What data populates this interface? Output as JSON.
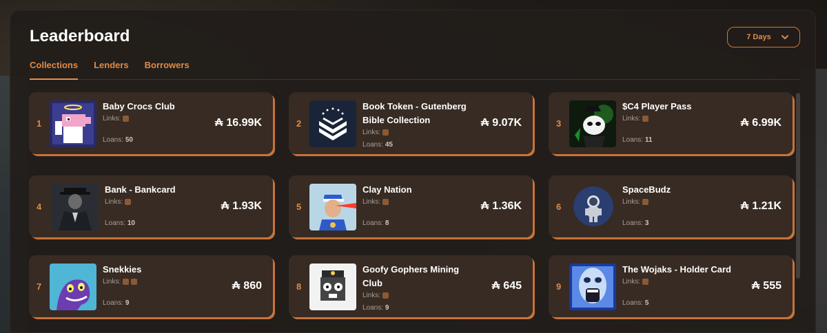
{
  "header": {
    "title": "Leaderboard",
    "period": "7 Days"
  },
  "tabs": [
    {
      "label": "Collections"
    },
    {
      "label": "Lenders"
    },
    {
      "label": "Borrowers"
    }
  ],
  "currency_symbol": "₳",
  "links_label": "Links:",
  "loans_label": "Loans:",
  "collections": [
    {
      "rank": "1",
      "name": "Baby Crocs Club",
      "volume": "16.99K",
      "loans": "50"
    },
    {
      "rank": "2",
      "name": "Book Token - Gutenberg Bible Collection",
      "volume": "9.07K",
      "loans": "45"
    },
    {
      "rank": "3",
      "name": "$C4 Player Pass",
      "volume": "6.99K",
      "loans": "11"
    },
    {
      "rank": "4",
      "name": "Bank - Bankcard",
      "volume": "1.93K",
      "loans": "10"
    },
    {
      "rank": "5",
      "name": "Clay Nation",
      "volume": "1.36K",
      "loans": "8"
    },
    {
      "rank": "6",
      "name": "SpaceBudz",
      "volume": "1.21K",
      "loans": "3"
    },
    {
      "rank": "7",
      "name": "Snekkies",
      "volume": "860",
      "loans": "9"
    },
    {
      "rank": "8",
      "name": "Goofy Gophers Mining Club",
      "volume": "645",
      "loans": "9"
    },
    {
      "rank": "9",
      "name": "The Wojaks - Holder Card",
      "volume": "555",
      "loans": "5"
    }
  ],
  "colors": {
    "accent": "#e08a47",
    "card_bg": "#3a2d24",
    "panel_bg": "#211d1a"
  }
}
